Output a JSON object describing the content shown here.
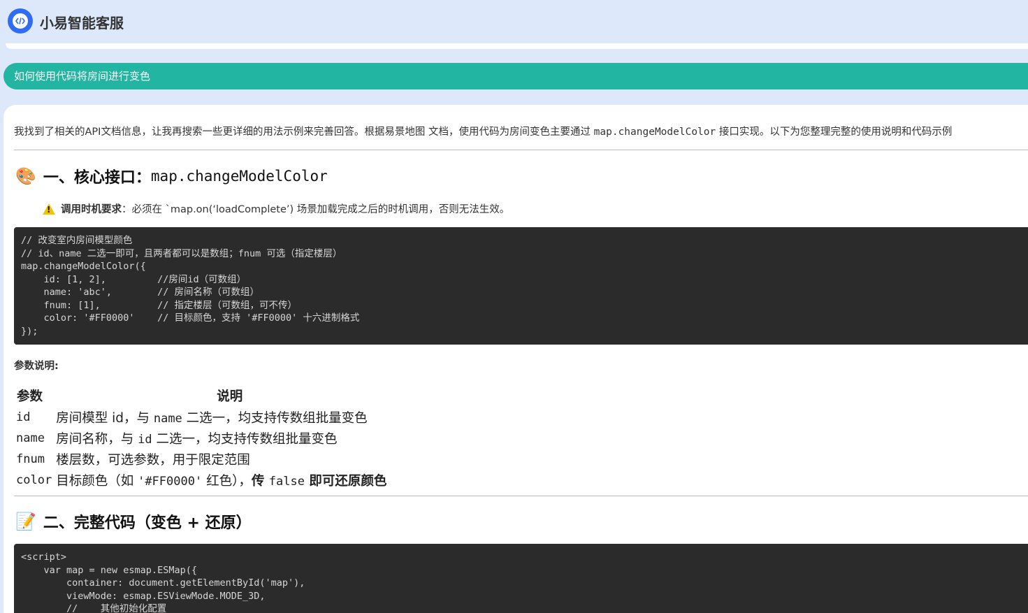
{
  "app": {
    "title": "小易智能客服",
    "logo_icon": "code-icon"
  },
  "question": {
    "text": "如何使用代码将房间进行变色"
  },
  "answer": {
    "intro": {
      "text_before": "我找到了相关的API文档信息，让我再搜索一些更详细的用法示例来完善回答。根据易景地图 文档，使用代码为房间变色主要通过 ",
      "code": "map.changeModelColor",
      "text_after": " 接口实现。以下为您整理完整的使用说明和代码示例"
    },
    "section1": {
      "emoji": "🎨",
      "title_prefix": "一、核心接口：",
      "title_code": "map.changeModelColor",
      "warning_label": "调用时机要求",
      "warning_text": "：必须在 `map.on(‘loadComplete’) 场景加载完成之后的时机调用，否则无法生效。",
      "code": "// 改变室内房间模型颜色\n// id、name 二选一即可，且两者都可以是数组；fnum 可选（指定楼层）\nmap.changeModelColor({\n    id: [1, 2],         //房间id（可数组）\n    name: 'abc',        // 房间名称（可数组）\n    fnum: [1],          // 指定楼层（可数组，可不传）\n    color: '#FF0000'    // 目标颜色，支持 '#FF0000' 十六进制格式\n});",
      "params_title": "参数说明:",
      "params_headers": [
        "参数",
        "说明"
      ],
      "params": [
        {
          "name": "id",
          "d1": "房间模型 id，与 ",
          "code": "name",
          "d2": " 二选一，均支持传数组批量变色",
          "bold": "",
          "code2": "",
          "bold2": ""
        },
        {
          "name": "name",
          "d1": "房间名称，与 ",
          "code": "id",
          "d2": " 二选一，均支持传数组批量变色",
          "bold": "",
          "code2": "",
          "bold2": ""
        },
        {
          "name": "fnum",
          "d1": "楼层数，可选参数，用于限定范围",
          "code": "",
          "d2": "",
          "bold": "",
          "code2": "",
          "bold2": ""
        },
        {
          "name": "color",
          "d1": "目标颜色（如 ",
          "code": "'#FF0000'",
          "d2": " 红色），",
          "bold": "传 ",
          "code2": "false",
          "bold2": " 即可还原颜色"
        }
      ]
    },
    "section2": {
      "emoji": "📝",
      "title": "二、完整代码（变色 + 还原）",
      "code": "<script>\n    var map = new esmap.ESMap({\n        container: document.getElementById('map'),\n        viewMode: esmap.ESViewMode.MODE_3D,\n        //    其他初始化配置"
    }
  }
}
